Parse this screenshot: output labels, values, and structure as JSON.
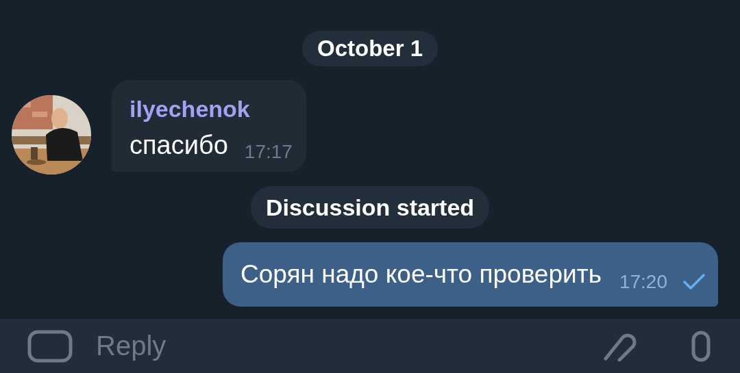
{
  "messages": [
    {
      "kind": "date",
      "text": "October 1"
    },
    {
      "kind": "incoming",
      "author": "ilyechenok",
      "text": "спасибо",
      "time": "17:17"
    },
    {
      "kind": "service",
      "text": "Discussion started"
    },
    {
      "kind": "outgoing",
      "text": "Сорян надо кое-что проверить",
      "time": "17:20",
      "read": false
    }
  ],
  "composer": {
    "placeholder": "Reply"
  }
}
